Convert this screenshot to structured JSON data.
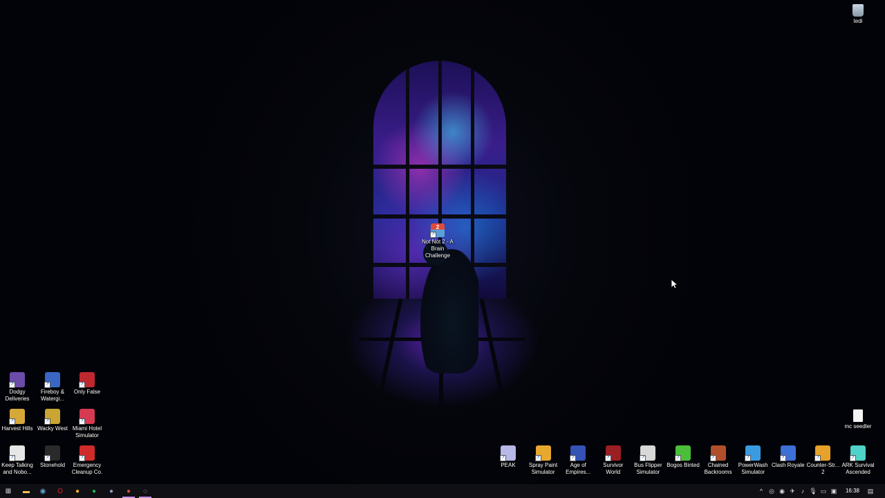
{
  "desktop": {
    "top_right": [
      {
        "label": "tedi",
        "icon": "recycle-bin-icon"
      }
    ],
    "center": [
      {
        "label": "Not Not 2 - A Brain Challenge",
        "icon": "game-shortcut-icon",
        "badge": "2"
      }
    ],
    "left_row_1": [
      {
        "label": "Dodgy Deliveries",
        "color": "#6b4ca8"
      },
      {
        "label": "Fireboy & Watergi...",
        "color": "#3a66c4"
      },
      {
        "label": "Only False",
        "color": "#c0282f"
      }
    ],
    "left_row_2": [
      {
        "label": "Harvest Hills",
        "color": "#d6a83a"
      },
      {
        "label": "Wacky West",
        "color": "#c9a534"
      },
      {
        "label": "Miami Hotel Simulator",
        "color": "#d63a52"
      }
    ],
    "left_row_3": [
      {
        "label": "Keep Talking and Nobo...",
        "color": "#e6e6e6"
      },
      {
        "label": "Stonehold",
        "color": "#2a2a2a"
      },
      {
        "label": "Emergency Cleanup Co.",
        "color": "#d12a2a"
      }
    ],
    "right_file": {
      "label": "mc seedler",
      "icon": "text-file-icon"
    },
    "bottom_row": [
      {
        "label": "PEAK",
        "color": "#b7b7e8"
      },
      {
        "label": "Spray Paint Simulator",
        "color": "#e6a92e"
      },
      {
        "label": "Age of Empires...",
        "color": "#3552b5"
      },
      {
        "label": "Survivor World",
        "color": "#9b1e22"
      },
      {
        "label": "Bus Flipper Simulator",
        "color": "#d8d8d8"
      },
      {
        "label": "Bogos Binted",
        "color": "#4bbf3a"
      },
      {
        "label": "Chained Backrooms",
        "color": "#b0502a"
      },
      {
        "label": "PowerWash Simulator",
        "color": "#3a9be0"
      },
      {
        "label": "Clash Royale",
        "color": "#3d6fd6"
      },
      {
        "label": "Counter-Str... 2",
        "color": "#e6a22a"
      },
      {
        "label": "ARK Survival Ascended",
        "color": "#4fd2c8"
      }
    ]
  },
  "taskbar": {
    "apps": [
      {
        "name": "start-button",
        "glyph": "⊞",
        "color": "#ffffff"
      },
      {
        "name": "file-explorer-icon",
        "glyph": "▬",
        "color": "#f2c14e"
      },
      {
        "name": "steam-icon",
        "glyph": "◉",
        "color": "#5fa4d8"
      },
      {
        "name": "opera-icon",
        "glyph": "O",
        "color": "#e0242f"
      },
      {
        "name": "chrome-icon",
        "glyph": "●",
        "color": "#e8b021"
      },
      {
        "name": "spotify-icon",
        "glyph": "●",
        "color": "#1db954"
      },
      {
        "name": "app-icon",
        "glyph": "●",
        "color": "#8aa0c0"
      },
      {
        "name": "chrome-profile-icon",
        "glyph": "●",
        "color": "#d85040"
      },
      {
        "name": "obs-icon",
        "glyph": "◌",
        "color": "#cfcfcf"
      }
    ],
    "tray": [
      "^",
      "◎",
      "◉",
      "✈",
      "♪",
      "🎙",
      "▭",
      "▣"
    ],
    "clock": "16:38"
  }
}
